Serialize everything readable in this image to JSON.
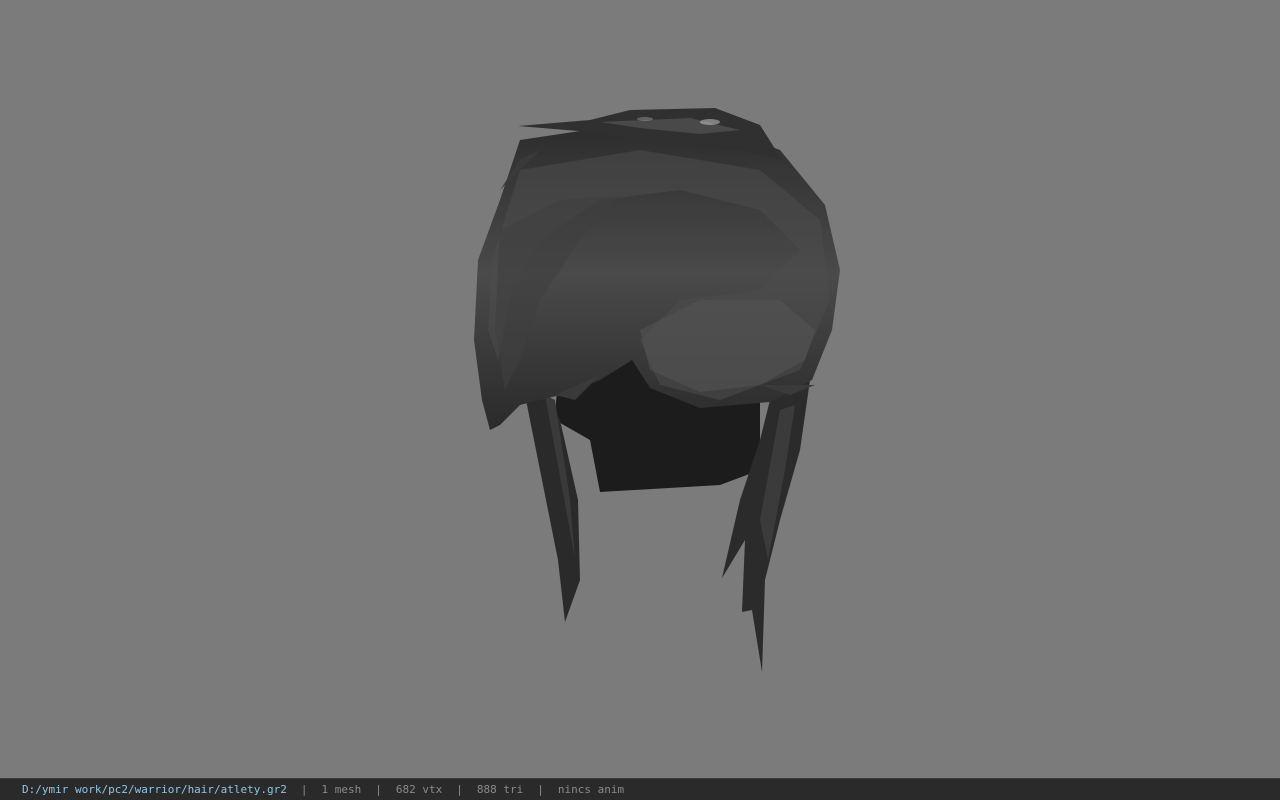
{
  "viewport": {
    "model_icon": "hair-mesh"
  },
  "status": {
    "path": "D:/ymir work/pc2/warrior/hair/atlety.gr2",
    "separator": "|",
    "meshes": "1 mesh",
    "vertices": "682 vtx",
    "triangles": "888 tri",
    "animation": "nincs anim"
  },
  "colors": {
    "background": "#7b7b7b",
    "status_bar": "#2a2a2a",
    "path_text": "#8fc4e6",
    "stat_text": "#8a8a8a"
  }
}
